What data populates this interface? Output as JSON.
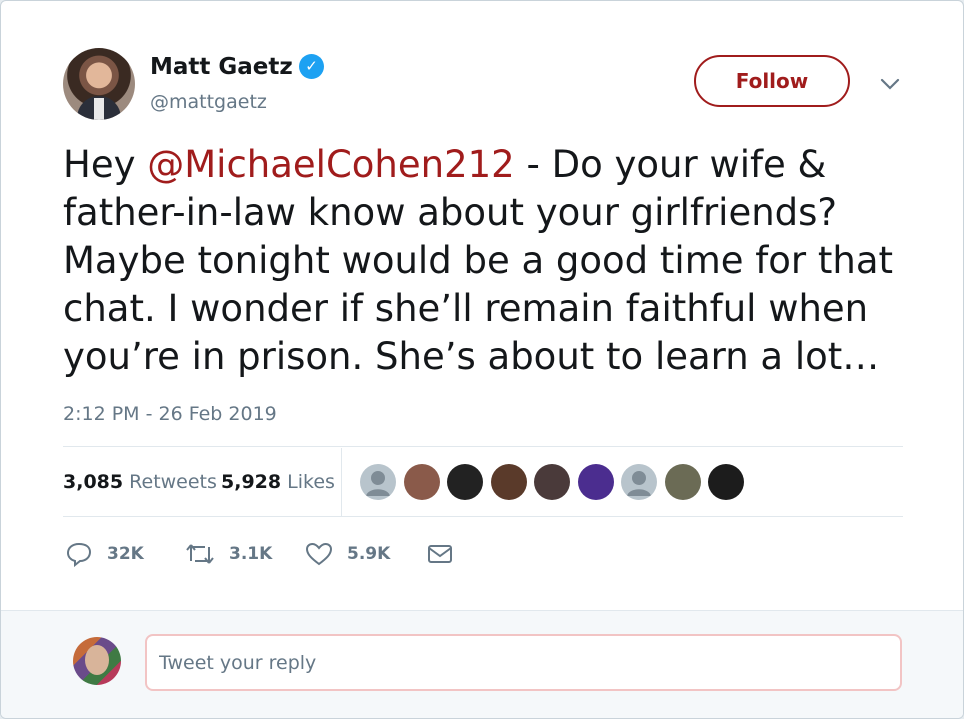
{
  "author": {
    "name": "Matt Gaetz",
    "handle": "@mattgaetz",
    "verified_icon": "verified-badge-icon"
  },
  "follow_label": "Follow",
  "tweet": {
    "prefix": "Hey ",
    "mention": "@MichaelCohen212",
    "body": " - Do your wife & father-in-law know about your girlfriends? Maybe tonight would be a good time for that chat. I wonder if she’ll remain faithful when you’re in prison.  She’s about to learn a lot…",
    "timestamp": "2:12 PM - 26 Feb 2019"
  },
  "stats": {
    "retweets_count": "3,085",
    "retweets_label": "Retweets",
    "likes_count": "5,928",
    "likes_label": "Likes"
  },
  "likers": [
    {
      "name": "liker-avatar-1",
      "color": "#b8c4cc"
    },
    {
      "name": "liker-avatar-2",
      "color": "#8a5a4a"
    },
    {
      "name": "liker-avatar-3",
      "color": "#222222"
    },
    {
      "name": "liker-avatar-4",
      "color": "#5a3a2a"
    },
    {
      "name": "liker-avatar-5",
      "color": "#4a3a3a"
    },
    {
      "name": "liker-avatar-6",
      "color": "#4b2d8f"
    },
    {
      "name": "liker-avatar-7",
      "color": "#b8c4cc"
    },
    {
      "name": "liker-avatar-8",
      "color": "#6b6b55"
    },
    {
      "name": "liker-avatar-9",
      "color": "#1c1c1c"
    }
  ],
  "actions": {
    "replies": "32K",
    "retweets": "3.1K",
    "likes": "5.9K"
  },
  "reply": {
    "placeholder": "Tweet your reply"
  },
  "colors": {
    "accent": "#a01c1c",
    "verified": "#1da1f2",
    "muted": "#657786"
  }
}
